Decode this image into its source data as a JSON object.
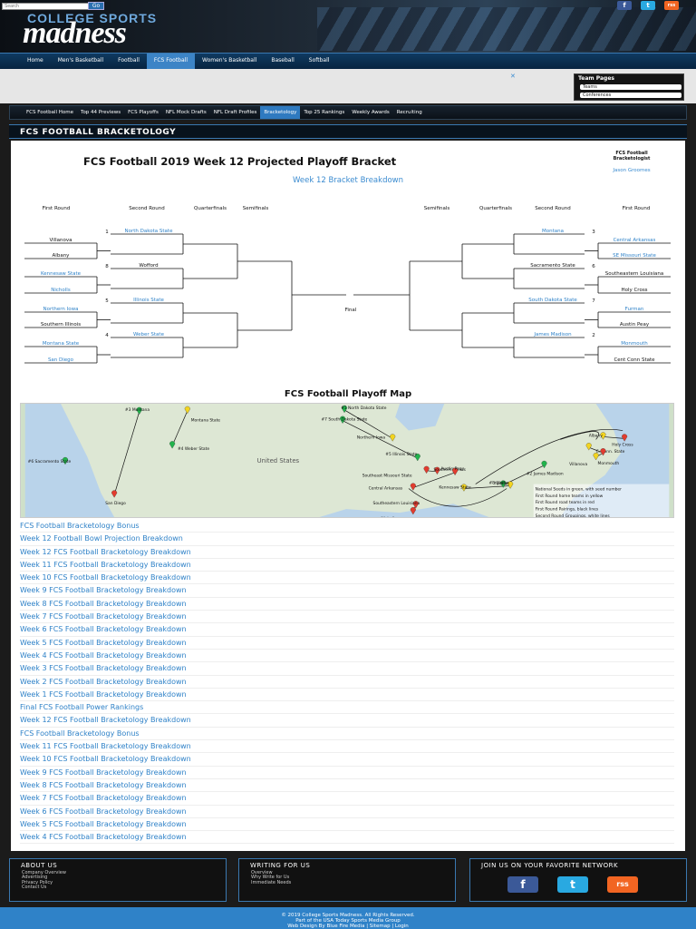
{
  "header": {
    "search_placeholder": "Search",
    "search_btn": "Go",
    "logo_top": "COLLEGE SPORTS",
    "logo_main": "madness",
    "social": [
      "f",
      "t",
      "rss"
    ]
  },
  "main_nav": [
    {
      "label": "Home"
    },
    {
      "label": "Men's Basketball"
    },
    {
      "label": "Football"
    },
    {
      "label": "FCS Football",
      "active": true
    },
    {
      "label": "Women's Basketball"
    },
    {
      "label": "Baseball"
    },
    {
      "label": "Softball"
    }
  ],
  "ad_close": "✕",
  "team_pages": {
    "title": "Team Pages",
    "items": [
      "Teams",
      "Conferences"
    ]
  },
  "sub_nav": [
    {
      "label": "FCS Football Home"
    },
    {
      "label": "Top 44 Previews"
    },
    {
      "label": "FCS Playoffs"
    },
    {
      "label": "NFL Mock Drafts"
    },
    {
      "label": "NFL Draft Profiles"
    },
    {
      "label": "Bracketology",
      "active": true
    },
    {
      "label": "Top 25 Rankings"
    },
    {
      "label": "Weekly Awards"
    },
    {
      "label": "Recruiting"
    }
  ],
  "section_title": "FCS FOOTBALL BRACKETOLOGY",
  "bracket": {
    "title": "FCS Football 2019 Week 12 Projected Playoff Bracket",
    "subtitle": "Week 12 Bracket Breakdown",
    "credit_role": "FCS Football Bracketologist",
    "credit_name": "Jason Groomes",
    "rounds_left": [
      "First Round",
      "Second Round",
      "Quarterfinals",
      "Semifinals"
    ],
    "rounds_right": [
      "Semifinals",
      "Quarterfinals",
      "Second Round",
      "First Round"
    ],
    "final_label": "Final",
    "left_first": [
      "Villanova",
      "Albany",
      "Kennesaw State",
      "Nicholls",
      "Northern Iowa",
      "Southern Illinois",
      "Montana State",
      "San Diego"
    ],
    "left_first_link": [
      false,
      false,
      true,
      true,
      true,
      false,
      true,
      true
    ],
    "left_second": [
      "North Dakota State",
      "Wofford",
      "Illinois State",
      "Weber State"
    ],
    "left_second_link": [
      true,
      false,
      true,
      true
    ],
    "left_seeds": [
      "1",
      "8",
      "5",
      "4"
    ],
    "right_first": [
      "Central Arkansas",
      "SE Missouri State",
      "Southeastern Louisiana",
      "Holy Cross",
      "Furman",
      "Austin Peay",
      "Monmouth",
      "Cent Conn State"
    ],
    "right_first_link": [
      true,
      true,
      false,
      false,
      true,
      false,
      true,
      false
    ],
    "right_second": [
      "Montana",
      "Sacramento State",
      "South Dakota State",
      "James Madison"
    ],
    "right_second_link": [
      true,
      false,
      true,
      true
    ],
    "right_seeds": [
      "3",
      "6",
      "7",
      "2"
    ]
  },
  "map": {
    "title": "FCS Football Playoff Map",
    "country": "United States",
    "labels": [
      "#3 Montana",
      "Montana State",
      "#4 Weber State",
      "#6 Sacramento State",
      "San Diego",
      "#1 North Dakota State",
      "#7 South Dakota State",
      "Northern Iowa",
      "#5 Illinois State",
      "Southern Illinois",
      "Southeast Missouri State",
      "Austin Peay",
      "Central Arkansas",
      "#2 James Madison",
      "#8 Wofford",
      "Furman",
      "Kennesaw State",
      "Southeastern Louisiana",
      "Nicholls",
      "Albany",
      "Holy Cross",
      "C. Conn. State",
      "Monmouth",
      "Villanova"
    ],
    "legend": [
      "National Seeds in green, with seed number",
      "First Round home teams in yellow",
      "First Round road teams in red",
      "First Round Pairings, black lines",
      "Second Round Groupings, white lines"
    ]
  },
  "links": [
    "FCS Football Bracketology Bonus",
    "Week 12 Football Bowl Projection Breakdown",
    "Week 12 FCS Football Bracketology Breakdown",
    "Week 11 FCS Football Bracketology Breakdown",
    "Week 10 FCS Football Bracketology Breakdown",
    "Week 9 FCS Football Bracketology Breakdown",
    "Week 8 FCS Football Bracketology Breakdown",
    "Week 7 FCS Football Bracketology Breakdown",
    "Week 6 FCS Football Bracketology Breakdown",
    "Week 5 FCS Football Bracketology Breakdown",
    "Week 4 FCS Football Bracketology Breakdown",
    "Week 3 FCS Football Bracketology Breakdown",
    "Week 2 FCS Football Bracketology Breakdown",
    "Week 1 FCS Football Bracketology Breakdown",
    "Final FCS Football Power Rankings",
    "Week 12 FCS Football Bracketology Breakdown",
    "FCS Football Bracketology Bonus",
    "Week 11 FCS Football Bracketology Breakdown",
    "Week 10 FCS Football Bracketology Breakdown",
    "Week 9 FCS Football Bracketology Breakdown",
    "Week 8 FCS Football Bracketology Breakdown",
    "Week 7 FCS Football Bracketology Breakdown",
    "Week 6 FCS Football Bracketology Breakdown",
    "Week 5 FCS Football Bracketology Breakdown",
    "Week 4 FCS Football Bracketology Breakdown"
  ],
  "footer": {
    "about": {
      "title": "ABOUT US",
      "items": [
        "Company Overview",
        "Advertising",
        "Privacy Policy",
        "Contact Us"
      ]
    },
    "writing": {
      "title": "WRITING FOR US",
      "items": [
        "Overview",
        "Why Write for Us",
        "Immediate Needs"
      ]
    },
    "join": {
      "title": "JOIN US ON YOUR FAVORITE NETWORK"
    },
    "copyright": "© 2019 College Sports Madness. All Rights Reserved.",
    "group": "Part of the USA Today Sports Media Group",
    "design": "Web Design By Blue Fire Media | Sitemap | Login"
  },
  "colors": {
    "accent": "#2f82c8",
    "nav_dark": "#072440",
    "facebook": "#3b5998",
    "twitter": "#29a9e1",
    "rss": "#f26522"
  }
}
